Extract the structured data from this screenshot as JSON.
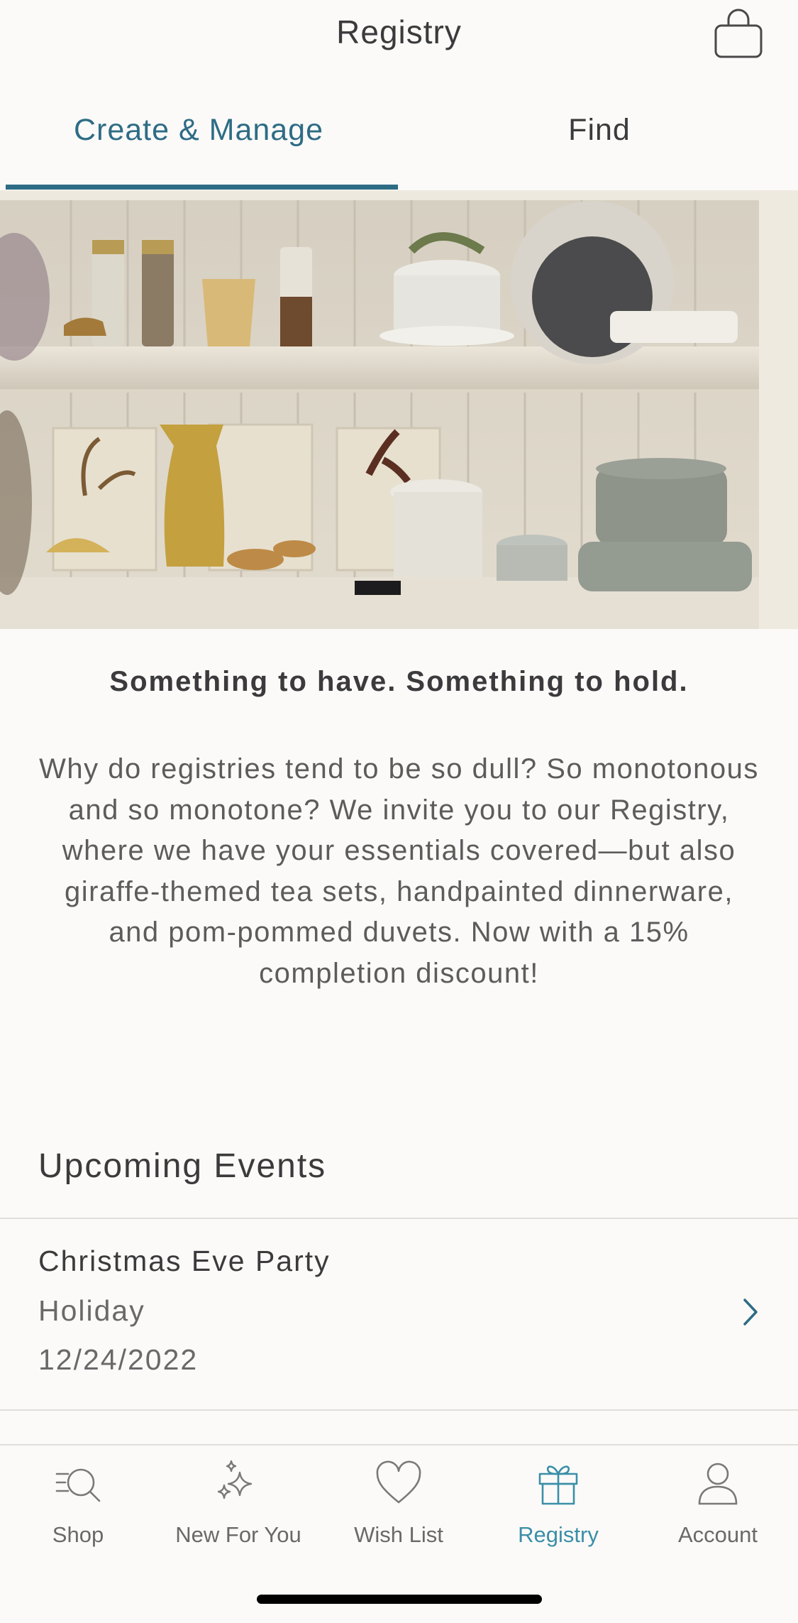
{
  "header": {
    "title": "Registry",
    "cart_icon": "shopping-bag-icon"
  },
  "tabs": [
    {
      "label": "Create & Manage",
      "active": true
    },
    {
      "label": "Find",
      "active": false
    }
  ],
  "hero": {
    "description": "kitchen shelves with dishes and vases"
  },
  "content": {
    "headline": "Something to have. Something to hold.",
    "intro": "Why do registries tend to be so dull? So monotonous and so monotone? We invite you to our Registry, where we have your essentials covered—but also giraffe-themed tea sets, handpainted dinnerware, and pom-pommed duvets. Now with a 15% completion discount!"
  },
  "events": {
    "title": "Upcoming Events",
    "items": [
      {
        "name": "Christmas Eve Party",
        "type": "Holiday",
        "date": "12/24/2022"
      }
    ]
  },
  "tabbar": {
    "items": [
      {
        "label": "Shop",
        "icon": "search-icon",
        "active": false
      },
      {
        "label": "New For You",
        "icon": "sparkles-icon",
        "active": false
      },
      {
        "label": "Wish List",
        "icon": "heart-icon",
        "active": false
      },
      {
        "label": "Registry",
        "icon": "gift-icon",
        "active": true
      },
      {
        "label": "Account",
        "icon": "person-icon",
        "active": false
      }
    ]
  },
  "colors": {
    "accent": "#2e6c85",
    "active_tab": "#3a8fa8",
    "background": "#fbfaf8",
    "text": "#3b3a3c"
  }
}
